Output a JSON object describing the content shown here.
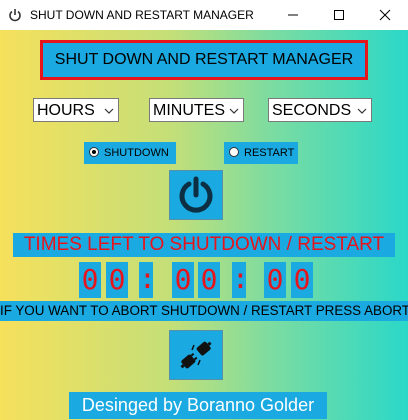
{
  "window": {
    "title": "SHUT DOWN AND RESTART MANAGER",
    "icons": [
      "power-icon",
      "minimize-icon",
      "maximize-icon",
      "close-icon"
    ]
  },
  "header": {
    "title": "SHUT DOWN AND RESTART MANAGER"
  },
  "selects": {
    "hours": "HOURS",
    "minutes": "MINUTES",
    "seconds": "SECONDS"
  },
  "options": {
    "shutdown_label": "SHUTDOWN",
    "restart_label": "RESTART",
    "selected": "SHUTDOWN"
  },
  "countdown": {
    "label": "TIMES LEFT TO SHUTDOWN / RESTART",
    "hours_tens": "0",
    "hours_ones": "0",
    "sep1": ":",
    "minutes_tens": "0",
    "minutes_ones": "0",
    "sep2": ":",
    "seconds_tens": "0",
    "seconds_ones": "0"
  },
  "abort": {
    "instruction": "IF YOU WANT TO ABORT SHUTDOWN / RESTART PRESS ABORT",
    "button_icon": "unplug-icon"
  },
  "footer": {
    "credit": "Desinged by Boranno Golder"
  },
  "colors": {
    "accent": "#1aa9e0",
    "alert_red": "#e8141c",
    "gradient_left": "#f6e05c",
    "gradient_right": "#2ad8c8"
  }
}
